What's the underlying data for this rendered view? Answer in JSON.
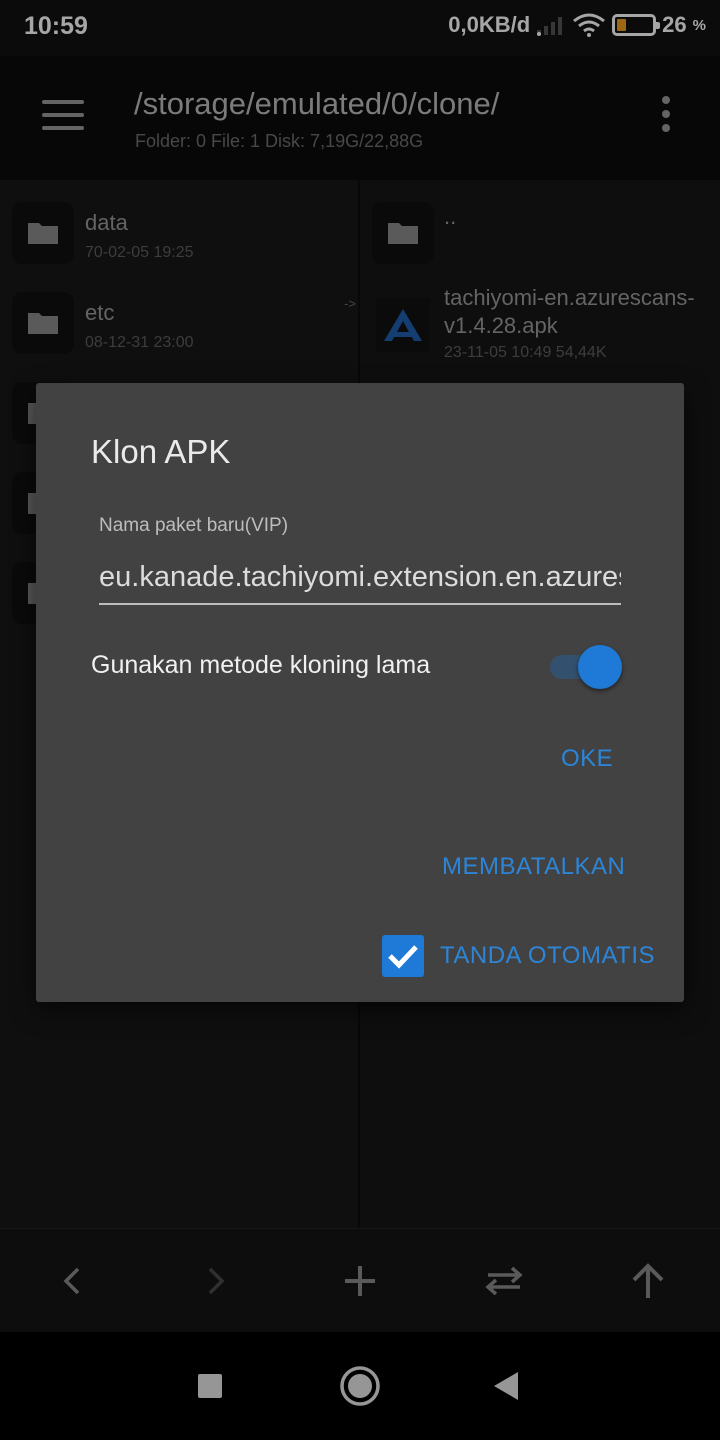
{
  "status_bar": {
    "time": "10:59",
    "network_speed": "0,0KB/d",
    "battery_percent": "26",
    "battery_percent_sign": "%",
    "battery_level": 0.26,
    "battery_color": "#f0a020"
  },
  "app_bar": {
    "path": "/storage/emulated/0/clone/",
    "info": "Folder: 0  File: 1  Disk: 7,19G/22,88G",
    "menu_icon": "hamburger-icon",
    "overflow_icon": "more-vert-icon"
  },
  "left_pane": {
    "items": [
      {
        "name": "data",
        "date": "70-02-05 19:25",
        "icon": "folder-icon"
      },
      {
        "name": "etc",
        "date": "08-12-31 23:00",
        "icon": "folder-icon"
      }
    ],
    "link_arrow": "->"
  },
  "right_pane": {
    "parent": {
      "name": "..",
      "icon": "folder-icon"
    },
    "file": {
      "name_line1": "tachiyomi-en.azurescans-",
      "name_line2": "v1.4.28.apk",
      "meta": "23-11-05 10:49  54,44K",
      "icon": "apk-app-icon"
    }
  },
  "dialog": {
    "title": "Klon APK",
    "package_label": "Nama paket baru(VIP)",
    "package_value": "eu.kanade.tachiyomi.extension.en.azurescans",
    "switch_label": "Gunakan metode kloning lama",
    "switch_on": true,
    "ok_label": "OKE",
    "cancel_label": "MEMBATALKAN",
    "auto_sign_label": "TANDA OTOMATIS",
    "auto_sign_checked": true,
    "accent_color": "#2d85d8"
  },
  "bottom_toolbar": {
    "buttons": [
      "back-arrow-icon",
      "forward-arrow-icon",
      "add-icon",
      "swap-icon",
      "up-arrow-icon"
    ]
  },
  "nav_bar": {
    "buttons": [
      "recent-apps-icon",
      "home-icon",
      "back-icon"
    ]
  }
}
